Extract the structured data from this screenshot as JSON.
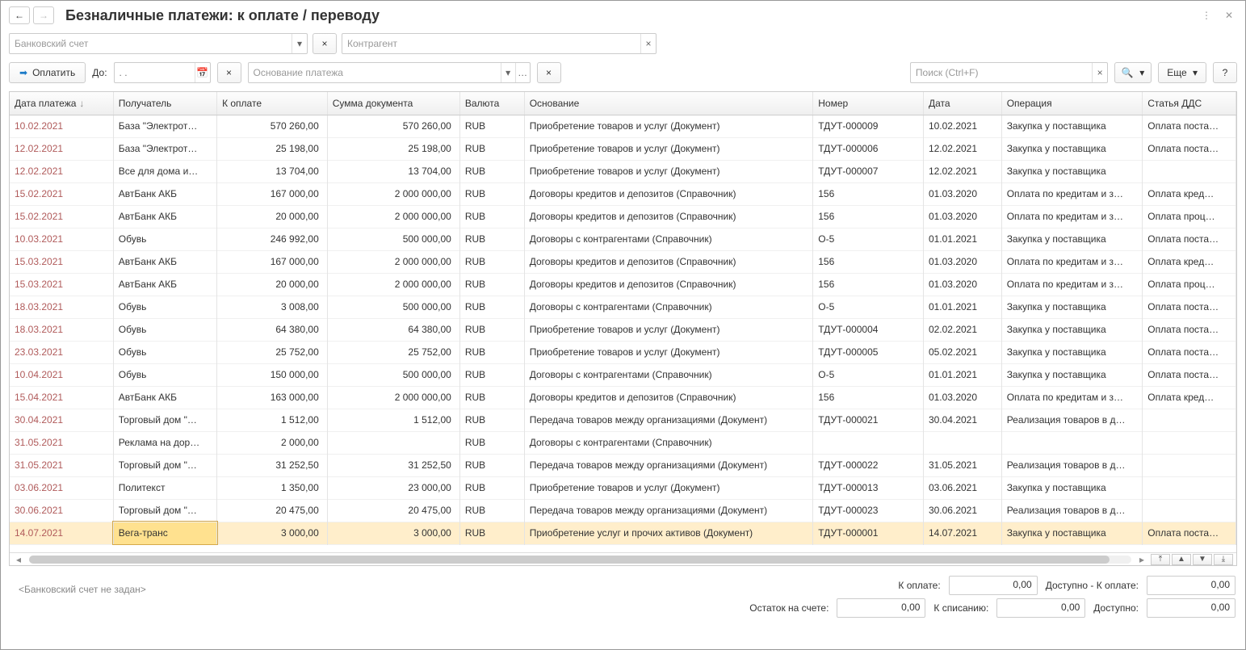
{
  "title": "Безналичные платежи: к оплате / переводу",
  "filters": {
    "bank_placeholder": "Банковский счет",
    "counterparty_placeholder": "Контрагент"
  },
  "toolbar": {
    "pay_label": "Оплатить",
    "until_label": "До:",
    "date_placeholder": ". .",
    "basis_placeholder": "Основание платежа",
    "search_placeholder": "Поиск (Ctrl+F)",
    "more_label": "Еще"
  },
  "cols": [
    "Дата платежа",
    "Получатель",
    "К оплате",
    "Сумма документа",
    "Валюта",
    "Основание",
    "Номер",
    "Дата",
    "Операция",
    "Статья ДДС"
  ],
  "rows": [
    [
      "10.02.2021",
      "База \"Электрот…",
      "570 260,00",
      "570 260,00",
      "RUB",
      "Приобретение товаров и услуг (Документ)",
      "ТДУТ-000009",
      "10.02.2021",
      "Закупка у поставщика",
      "Оплата поста…"
    ],
    [
      "12.02.2021",
      "База \"Электрот…",
      "25 198,00",
      "25 198,00",
      "RUB",
      "Приобретение товаров и услуг (Документ)",
      "ТДУТ-000006",
      "12.02.2021",
      "Закупка у поставщика",
      "Оплата поста…"
    ],
    [
      "12.02.2021",
      "Все для дома и…",
      "13 704,00",
      "13 704,00",
      "RUB",
      "Приобретение товаров и услуг (Документ)",
      "ТДУТ-000007",
      "12.02.2021",
      "Закупка у поставщика",
      ""
    ],
    [
      "15.02.2021",
      "АвтБанк АКБ",
      "167 000,00",
      "2 000 000,00",
      "RUB",
      "Договоры кредитов и депозитов (Справочник)",
      "156",
      "01.03.2020",
      "Оплата по кредитам и з…",
      "Оплата кред…"
    ],
    [
      "15.02.2021",
      "АвтБанк АКБ",
      "20 000,00",
      "2 000 000,00",
      "RUB",
      "Договоры кредитов и депозитов (Справочник)",
      "156",
      "01.03.2020",
      "Оплата по кредитам и з…",
      "Оплата проц…"
    ],
    [
      "10.03.2021",
      "Обувь",
      "246 992,00",
      "500 000,00",
      "RUB",
      "Договоры с контрагентами (Справочник)",
      "О-5",
      "01.01.2021",
      "Закупка у поставщика",
      "Оплата поста…"
    ],
    [
      "15.03.2021",
      "АвтБанк АКБ",
      "167 000,00",
      "2 000 000,00",
      "RUB",
      "Договоры кредитов и депозитов (Справочник)",
      "156",
      "01.03.2020",
      "Оплата по кредитам и з…",
      "Оплата кред…"
    ],
    [
      "15.03.2021",
      "АвтБанк АКБ",
      "20 000,00",
      "2 000 000,00",
      "RUB",
      "Договоры кредитов и депозитов (Справочник)",
      "156",
      "01.03.2020",
      "Оплата по кредитам и з…",
      "Оплата проц…"
    ],
    [
      "18.03.2021",
      "Обувь",
      "3 008,00",
      "500 000,00",
      "RUB",
      "Договоры с контрагентами (Справочник)",
      "О-5",
      "01.01.2021",
      "Закупка у поставщика",
      "Оплата поста…"
    ],
    [
      "18.03.2021",
      "Обувь",
      "64 380,00",
      "64 380,00",
      "RUB",
      "Приобретение товаров и услуг (Документ)",
      "ТДУТ-000004",
      "02.02.2021",
      "Закупка у поставщика",
      "Оплата поста…"
    ],
    [
      "23.03.2021",
      "Обувь",
      "25 752,00",
      "25 752,00",
      "RUB",
      "Приобретение товаров и услуг (Документ)",
      "ТДУТ-000005",
      "05.02.2021",
      "Закупка у поставщика",
      "Оплата поста…"
    ],
    [
      "10.04.2021",
      "Обувь",
      "150 000,00",
      "500 000,00",
      "RUB",
      "Договоры с контрагентами (Справочник)",
      "О-5",
      "01.01.2021",
      "Закупка у поставщика",
      "Оплата поста…"
    ],
    [
      "15.04.2021",
      "АвтБанк АКБ",
      "163 000,00",
      "2 000 000,00",
      "RUB",
      "Договоры кредитов и депозитов (Справочник)",
      "156",
      "01.03.2020",
      "Оплата по кредитам и з…",
      "Оплата кред…"
    ],
    [
      "30.04.2021",
      "Торговый дом \"…",
      "1 512,00",
      "1 512,00",
      "RUB",
      "Передача товаров между организациями (Документ)",
      "ТДУТ-000021",
      "30.04.2021",
      "Реализация товаров в д…",
      ""
    ],
    [
      "31.05.2021",
      "Реклама на дор…",
      "2 000,00",
      "",
      "RUB",
      "Договоры с контрагентами (Справочник)",
      "",
      "",
      "",
      ""
    ],
    [
      "31.05.2021",
      "Торговый дом \"…",
      "31 252,50",
      "31 252,50",
      "RUB",
      "Передача товаров между организациями (Документ)",
      "ТДУТ-000022",
      "31.05.2021",
      "Реализация товаров в д…",
      ""
    ],
    [
      "03.06.2021",
      "Политекст",
      "1 350,00",
      "23 000,00",
      "RUB",
      "Приобретение товаров и услуг (Документ)",
      "ТДУТ-000013",
      "03.06.2021",
      "Закупка у поставщика",
      ""
    ],
    [
      "30.06.2021",
      "Торговый дом \"…",
      "20 475,00",
      "20 475,00",
      "RUB",
      "Передача товаров между организациями (Документ)",
      "ТДУТ-000023",
      "30.06.2021",
      "Реализация товаров в д…",
      ""
    ],
    [
      "14.07.2021",
      "Вега-транс",
      "3 000,00",
      "3 000,00",
      "RUB",
      "Приобретение услуг и прочих активов (Документ)",
      "ТДУТ-000001",
      "14.07.2021",
      "Закупка у поставщика",
      "Оплата поста…"
    ]
  ],
  "selected_row": 18,
  "footer": {
    "to_pay_label": "К оплате:",
    "to_pay": "0,00",
    "avail_minus_label": "Доступно - К оплате:",
    "avail_minus": "0,00",
    "balance_label": "Остаток на счете:",
    "balance": "0,00",
    "writeoff_label": "К списанию:",
    "writeoff": "0,00",
    "available_label": "Доступно:",
    "available": "0,00",
    "bank_note": "<Банковский счет не задан>"
  }
}
